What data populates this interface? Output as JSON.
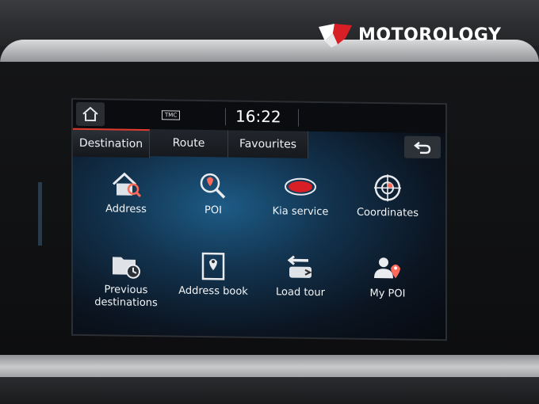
{
  "brand": {
    "text": "MOTOROLOGY"
  },
  "status": {
    "tmc": "TMC",
    "time": "16:22"
  },
  "tabs": [
    {
      "label": "Destination",
      "active": true
    },
    {
      "label": "Route",
      "active": false
    },
    {
      "label": "Favourites",
      "active": false
    }
  ],
  "items": [
    {
      "label": "Address",
      "icon": "house-search-icon"
    },
    {
      "label": "POI",
      "icon": "poi-search-icon"
    },
    {
      "label": "Kia service",
      "icon": "kia-logo-icon"
    },
    {
      "label": "Coordinates",
      "icon": "crosshair-icon"
    },
    {
      "label": "Previous destinations",
      "icon": "folder-clock-icon"
    },
    {
      "label": "Address book",
      "icon": "address-book-icon"
    },
    {
      "label": "Load tour",
      "icon": "load-tour-icon"
    },
    {
      "label": "My POI",
      "icon": "person-pin-icon"
    }
  ],
  "colors": {
    "accent": "#e33a2c",
    "text": "#f2f4f6"
  }
}
